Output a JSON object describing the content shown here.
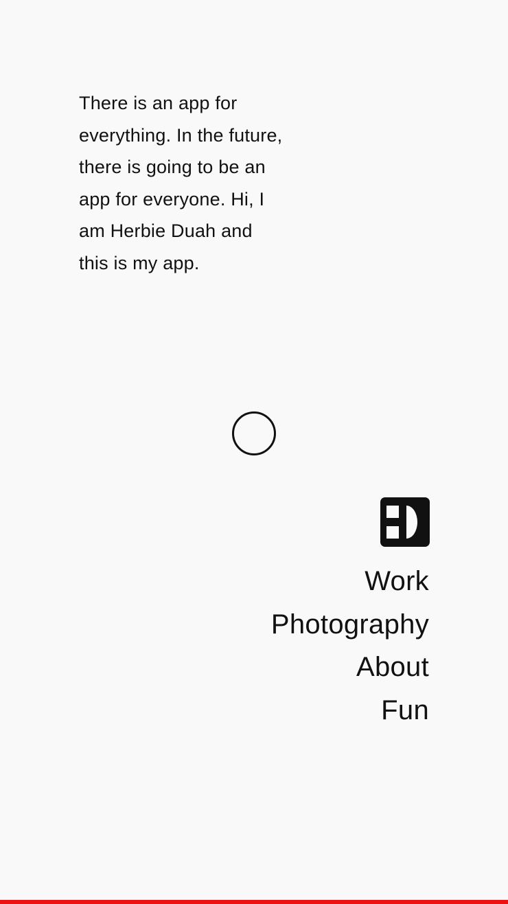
{
  "intro": {
    "text": "There is an app for everything. In the future, there is going to be an app for everyone. Hi, I am Herbie Duah and this is my app."
  },
  "logo": {
    "icon": "hd-monogram-icon",
    "color": "#111111"
  },
  "nav": {
    "items": [
      {
        "label": "Work"
      },
      {
        "label": "Photography"
      },
      {
        "label": "About"
      },
      {
        "label": "Fun"
      }
    ]
  },
  "cursor": {
    "icon": "circle-cursor-icon"
  },
  "colors": {
    "background": "#f9f9f9",
    "text": "#111111",
    "accent_bar": "#ee1111"
  }
}
